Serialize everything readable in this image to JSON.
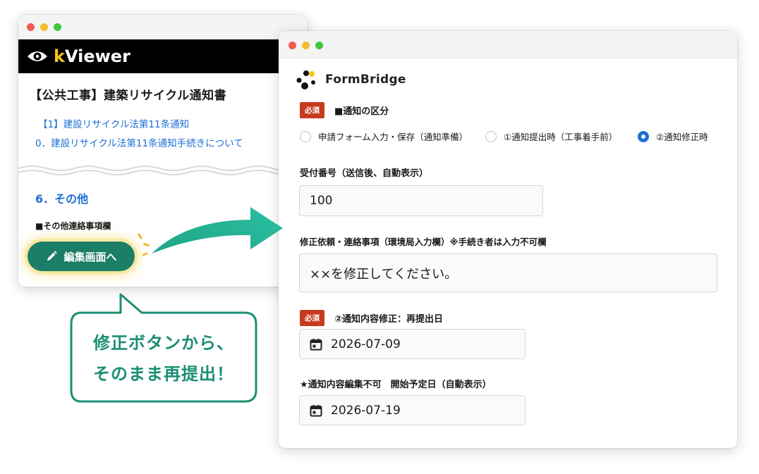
{
  "kviewer": {
    "brand_k": "k",
    "brand_rest": "Viewer",
    "doc_title": "【公共工事】建築リサイクル通知書",
    "links": [
      "【1】建設リサイクル法第11条通知",
      "0．建設リサイクル法第11条通知手続きについて"
    ],
    "section": "6．その他",
    "note_label": "■その他連絡事項欄",
    "edit_button": "編集画面へ"
  },
  "formbridge": {
    "brand": "FormBridge",
    "required_badge": "必須",
    "notice_type": {
      "label": "■通知の区分",
      "options": [
        "申請フォーム入力・保存（通知準備）",
        "①通知提出時（工事着手前）",
        "②通知修正時"
      ],
      "selected": "②通知修正時"
    },
    "receipt_no": {
      "label": "受付番号（送信後、自動表示）",
      "value": "100"
    },
    "correction_request": {
      "label": "修正依頼・連絡事項（環境局入力欄）※手続き者は入力不可欄",
      "value": "××を修正してください。"
    },
    "resubmit_date": {
      "label": "②通知内容修正：再提出日",
      "value": "2026-07-09"
    },
    "start_date": {
      "label": "★通知内容編集不可　開始予定日（自動表示）",
      "value": "2026-07-19"
    }
  },
  "callout": {
    "line1": "修正ボタンから、",
    "line2": "そのまま再提出！"
  },
  "colors": {
    "accent_green": "#1b8f74",
    "button_green": "#1b7e66",
    "link_blue": "#1b6fd4",
    "required_red": "#c83a1e",
    "brand_yellow": "#f5c518"
  }
}
